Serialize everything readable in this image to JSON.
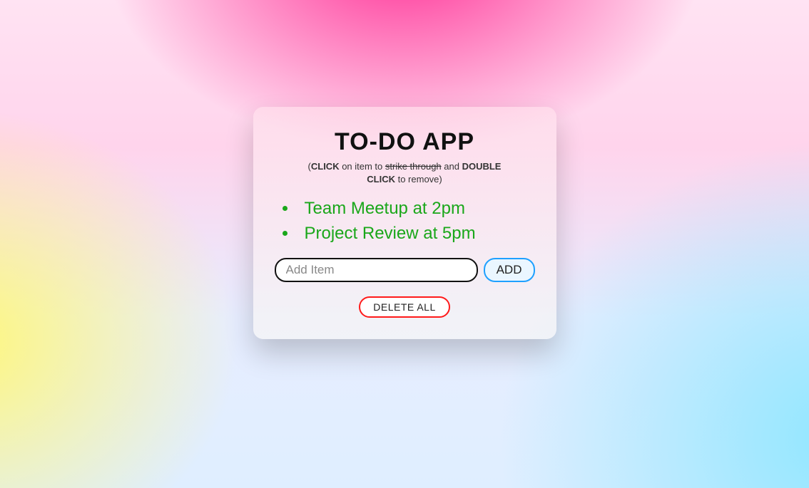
{
  "title": "TO-DO APP",
  "subtitle_prefix": "(",
  "subtitle_click": "CLICK",
  "subtitle_mid1": " on item to ",
  "subtitle_strike": "strike through",
  "subtitle_mid2": " and ",
  "subtitle_dblclick": "DOUBLE CLICK",
  "subtitle_suffix": " to remove)",
  "items": [
    "Team Meetup at 2pm",
    "Project Review at 5pm"
  ],
  "input_placeholder": "Add Item",
  "add_label": "ADD",
  "delete_all_label": "DELETE ALL"
}
